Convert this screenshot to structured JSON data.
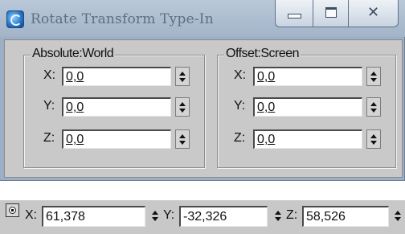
{
  "window": {
    "title": "Rotate Transform Type-In",
    "close_glyph": "✕"
  },
  "absolute": {
    "label": "Absolute:World",
    "fields": [
      {
        "axis": "X:",
        "value": "0,0"
      },
      {
        "axis": "Y:",
        "value": "0,0"
      },
      {
        "axis": "Z:",
        "value": "0,0"
      }
    ]
  },
  "offset": {
    "label": "Offset:Screen",
    "fields": [
      {
        "axis": "X:",
        "value": "0,0"
      },
      {
        "axis": "Y:",
        "value": "0,0"
      },
      {
        "axis": "Z:",
        "value": "0,0"
      }
    ]
  },
  "toolbar": {
    "lock_icon": "absolute-mode-toggle-icon",
    "fields": [
      {
        "axis": "X:",
        "value": "61,378"
      },
      {
        "axis": "Y:",
        "value": "-32,326"
      },
      {
        "axis": "Z:",
        "value": "58,526"
      }
    ]
  },
  "colors": {
    "title_bar": "#a3b4c9",
    "panel": "#c9c9c9",
    "field_bg": "#ffffff"
  }
}
